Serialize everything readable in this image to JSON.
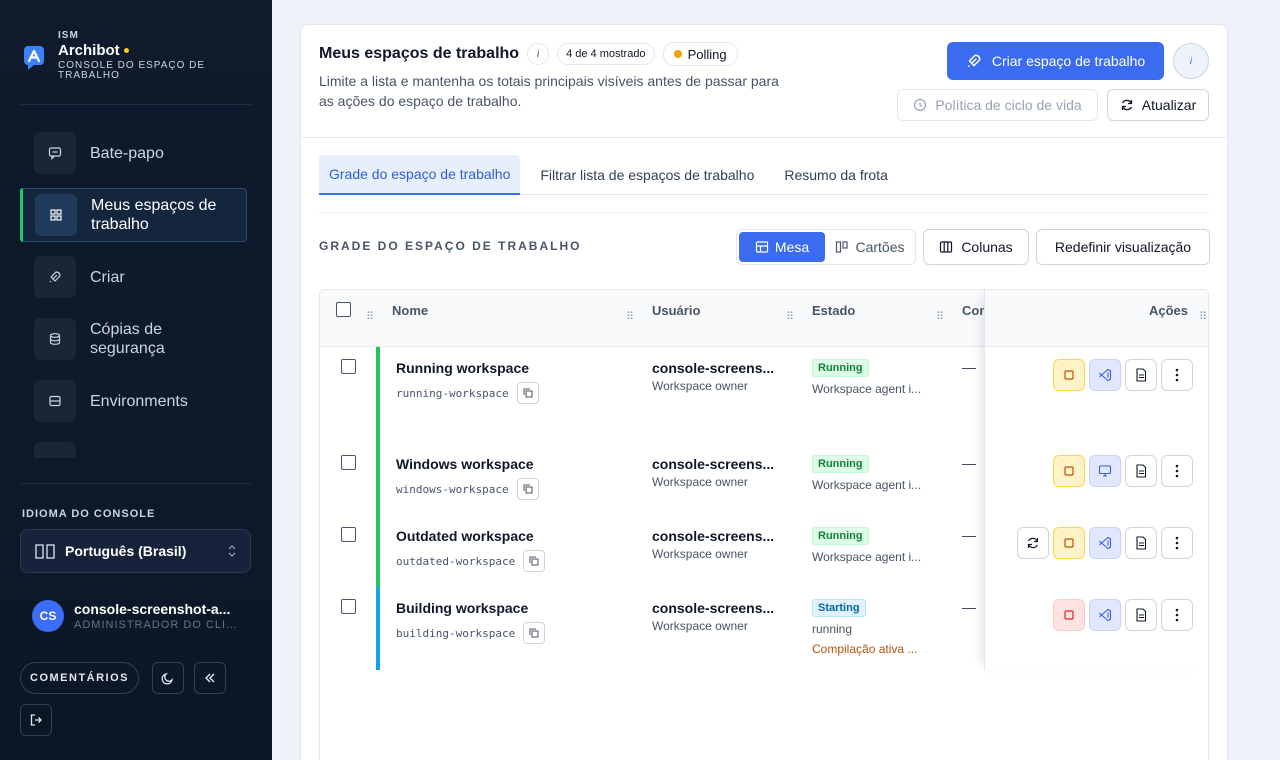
{
  "colors": {
    "accent": "#3b6cf0",
    "sidebar": "#0f1b2d",
    "running": "#22c55e",
    "starting": "#0ea5e9",
    "polling": "#f59e0b"
  },
  "brand": {
    "small": "ISM",
    "name": "Archibot",
    "subtitle": "CONSOLE DO ESPAÇO DE TRABALHO"
  },
  "sidebar": {
    "items": [
      {
        "label": "Bate-papo",
        "icon": "chat-icon"
      },
      {
        "label": "Meus espaços de trabalho",
        "icon": "grid-icon",
        "active": true
      },
      {
        "label": "Criar",
        "icon": "rocket-icon"
      },
      {
        "label": "Cópias de segurança",
        "icon": "database-icon"
      },
      {
        "label": "Environments",
        "icon": "server-icon"
      }
    ],
    "language_title": "IDIOMA DO CONSOLE",
    "language_value": "Português (Brasil)",
    "user": {
      "initials": "CS",
      "name": "console-screenshot-a...",
      "role": "ADMINISTRADOR DO CLIE..."
    },
    "feedback_label": "COMENTÁRIOS"
  },
  "header": {
    "title": "Meus espaços de trabalho",
    "info": "i",
    "count_pill": "4 de 4 mostrado",
    "polling_pill": "Polling",
    "subtitle": "Limite a lista e mantenha os totais principais visíveis antes de passar para as ações do espaço de trabalho.",
    "create_button": "Criar espaço de trabalho",
    "info_button": "i",
    "lifecycle_button": "Política de ciclo de vida",
    "refresh_button": "Atualizar"
  },
  "tabs": [
    "Grade do espaço de trabalho",
    "Filtrar lista de espaços de trabalho",
    "Resumo da frota"
  ],
  "grid": {
    "title": "GRADE DO ESPAÇO DE TRABALHO",
    "view_table": "Mesa",
    "view_cards": "Cartões",
    "columns_button": "Colunas",
    "reset_button": "Redefinir visualização"
  },
  "table": {
    "columns": [
      "Nome",
      "Usuário",
      "Estado",
      "Con",
      "Ações"
    ],
    "rows": [
      {
        "name": "Running workspace",
        "slug": "running-workspace",
        "user": "console-screens...",
        "owner": "Workspace owner",
        "status": "Running",
        "state": "Workspace agent i...",
        "state2": "",
        "col4": "—"
      },
      {
        "name": "Windows workspace",
        "slug": "windows-workspace",
        "user": "console-screens...",
        "owner": "Workspace owner",
        "status": "Running",
        "state": "Workspace agent i...",
        "state2": "",
        "col4": "—"
      },
      {
        "name": "Outdated workspace",
        "slug": "outdated-workspace",
        "user": "console-screens...",
        "owner": "Workspace owner",
        "status": "Running",
        "state": "Workspace agent i...",
        "state2": "",
        "col4": "—"
      },
      {
        "name": "Building workspace",
        "slug": "building-workspace",
        "user": "console-screens...",
        "owner": "Workspace owner",
        "status": "Starting",
        "state": "running",
        "state2": "Compilação ativa ...",
        "col4": "—"
      }
    ]
  }
}
